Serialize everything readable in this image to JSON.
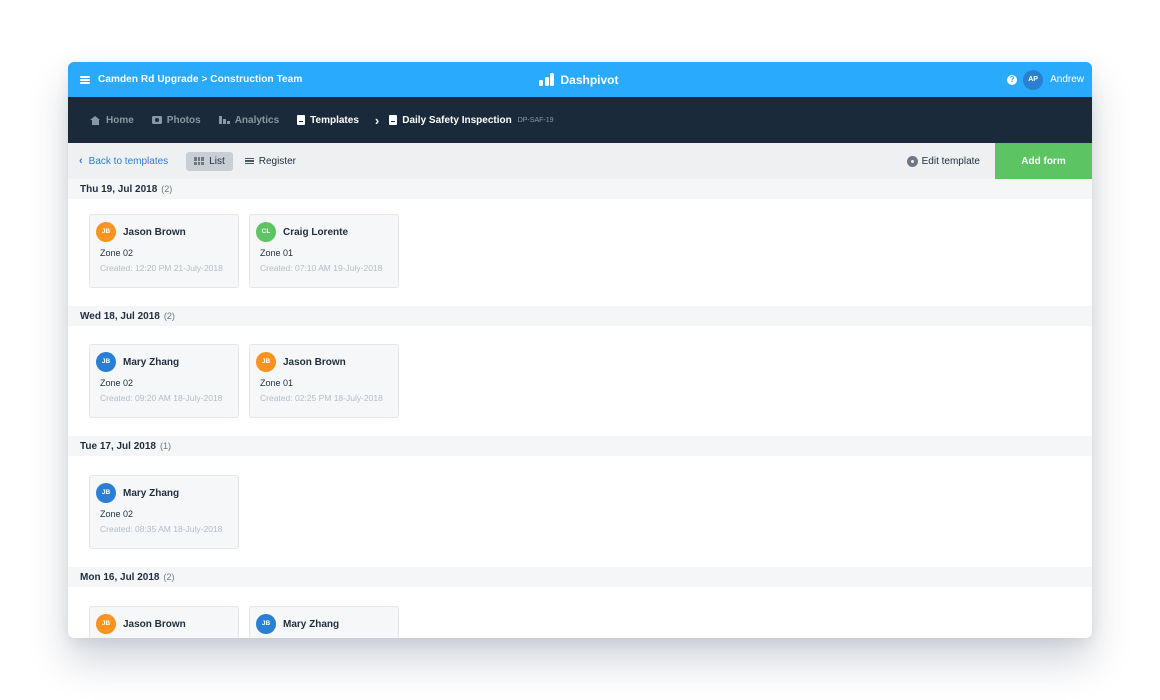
{
  "topbar": {
    "project_path": "Camden Rd Upgrade > Construction Team",
    "brand": "Dashpivot",
    "help_icon": "question-circle-icon",
    "user_initials": "AP",
    "user_name": "Andrew",
    "colors": {
      "topbar": "#29aafc",
      "avatar": "#2a7fd4"
    }
  },
  "nav": {
    "items": [
      {
        "label": "Home",
        "icon": "home-icon"
      },
      {
        "label": "Photos",
        "icon": "camera-icon"
      },
      {
        "label": "Analytics",
        "icon": "area-chart-icon"
      },
      {
        "label": "Templates",
        "icon": "document-icon"
      }
    ],
    "current": {
      "label": "Daily Safety Inspection",
      "code": "DP-SAF-19",
      "icon": "document-icon"
    }
  },
  "toolbar": {
    "back_label": "Back to templates",
    "list_label": "List",
    "register_label": "Register",
    "edit_template_label": "Edit template",
    "add_form_label": "Add form",
    "active_view": "List",
    "colors": {
      "add_form": "#5cc461",
      "link": "#2a7fd4"
    }
  },
  "groups": [
    {
      "date": "Thu 19, Jul 2018",
      "count": "(2)",
      "cards": [
        {
          "initials": "JB",
          "avatar_color": "#f7931e",
          "author": "Jason Brown",
          "zone": "Zone 02",
          "created": "Created: 12:20 PM 21-July-2018"
        },
        {
          "initials": "CL",
          "avatar_color": "#5cc461",
          "author": "Craig Lorente",
          "zone": "Zone 01",
          "created": "Created: 07:10 AM 19-July-2018"
        }
      ]
    },
    {
      "date": "Wed 18, Jul 2018",
      "count": "(2)",
      "cards": [
        {
          "initials": "JB",
          "avatar_color": "#2a7fd4",
          "author": "Mary Zhang",
          "zone": "Zone 02",
          "created": "Created: 09:20 AM 18-July-2018"
        },
        {
          "initials": "JB",
          "avatar_color": "#f7931e",
          "author": "Jason Brown",
          "zone": "Zone 01",
          "created": "Created: 02:25 PM 18-July-2018"
        }
      ]
    },
    {
      "date": "Tue 17, Jul 2018",
      "count": "(1)",
      "cards": [
        {
          "initials": "JB",
          "avatar_color": "#2a7fd4",
          "author": "Mary Zhang",
          "zone": "Zone 02",
          "created": "Created: 08:35 AM 18-July-2018"
        }
      ]
    },
    {
      "date": "Mon 16, Jul 2018",
      "count": "(2)",
      "cards": [
        {
          "initials": "JB",
          "avatar_color": "#f7931e",
          "author": "Jason Brown",
          "zone": "",
          "created": ""
        },
        {
          "initials": "JB",
          "avatar_color": "#2a7fd4",
          "author": "Mary Zhang",
          "zone": "",
          "created": ""
        }
      ]
    }
  ]
}
